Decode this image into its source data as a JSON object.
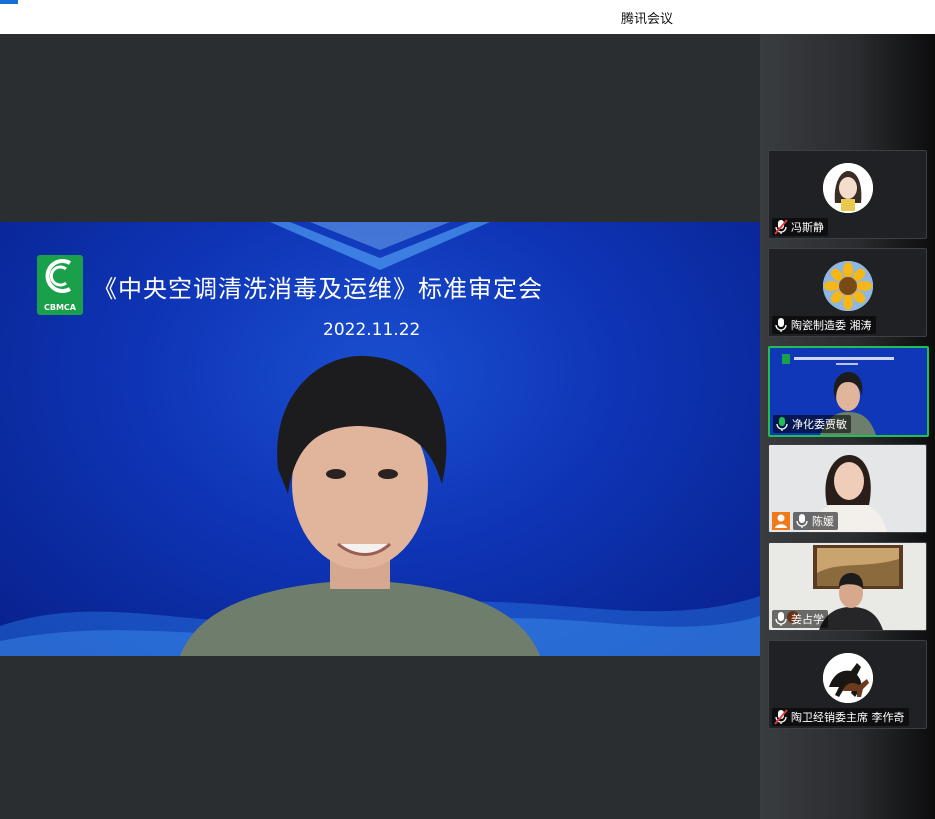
{
  "window": {
    "title": "腾讯会议"
  },
  "presentation": {
    "logo_text": "CBMCA",
    "title": "《中央空调清洗消毒及运维》标准审定会",
    "date": "2022.11.22"
  },
  "participants": [
    {
      "name": "冯斯静",
      "mic": "muted",
      "icon": "female-cartoon-avatar"
    },
    {
      "name": "陶瓷制造委 湘涛",
      "mic": "on",
      "icon": "sunflower-avatar"
    },
    {
      "name": "净化委贾敏",
      "mic": "speaking",
      "icon": "video-feed",
      "active": true
    },
    {
      "name": "陈媛",
      "mic": "on",
      "icon": "video-feed",
      "host_badge": true
    },
    {
      "name": "姜占学",
      "mic": "on",
      "icon": "video-feed"
    },
    {
      "name": "陶卫经销委主席 李作奇",
      "mic": "muted",
      "icon": "horse-avatar"
    }
  ],
  "colors": {
    "speaking": "#1fbf52",
    "host_badge": "#f07a1a",
    "slide_blue": "#0e34b5"
  }
}
